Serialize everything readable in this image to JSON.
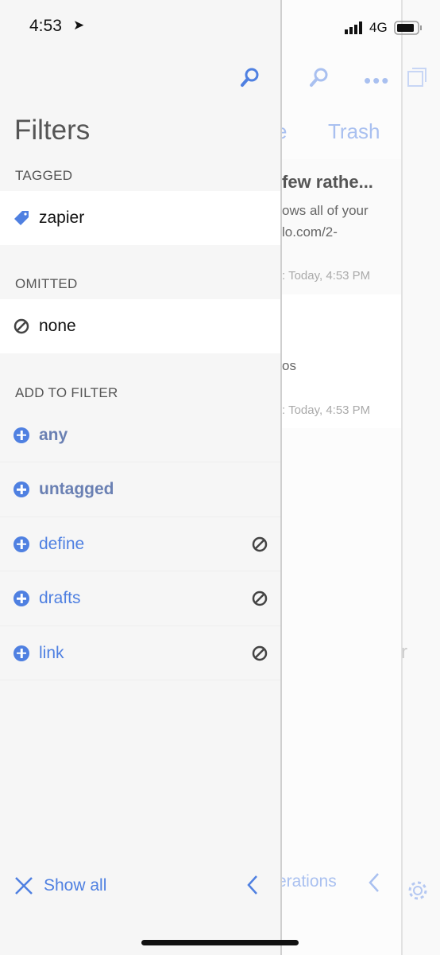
{
  "status": {
    "time": "4:53",
    "network": "4G"
  },
  "background": {
    "tab_partial": "e",
    "tab_trash": "Trash",
    "note1_title": "few rathe...",
    "note1_line1": "ows all of your",
    "note1_line2": "lo.com/2-",
    "note1_time": ": Today, 4:53 PM",
    "note2_line": "os",
    "note2_time": ": Today, 4:53 PM",
    "bottom_text": "erations",
    "side_char": "r"
  },
  "filters": {
    "title": "Filters",
    "tagged_header": "TAGGED",
    "tagged": [
      {
        "label": "zapier"
      }
    ],
    "omitted_header": "OMITTED",
    "omitted": [
      {
        "label": "none"
      }
    ],
    "add_header": "ADD TO FILTER",
    "add_items": [
      {
        "label": "any",
        "special": true
      },
      {
        "label": "untagged",
        "special": true
      },
      {
        "label": "define",
        "omit": true
      },
      {
        "label": "drafts",
        "omit": true
      },
      {
        "label": "link",
        "omit": true
      }
    ],
    "show_all": "Show all"
  },
  "colors": {
    "accent": "#4f80e1",
    "special": "#6a80b3",
    "faint_accent": "#a9c0f0"
  }
}
